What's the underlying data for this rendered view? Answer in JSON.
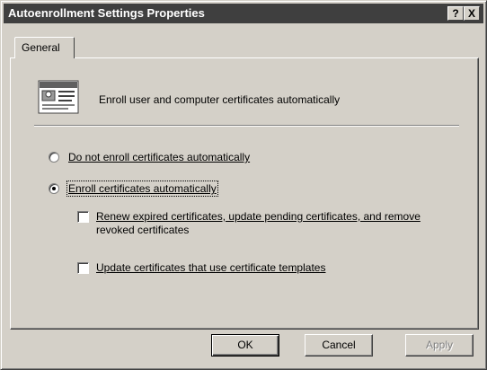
{
  "window": {
    "title": "Autoenrollment Settings Properties",
    "help_label": "?",
    "close_label": "X"
  },
  "tabs": [
    {
      "label": "General",
      "selected": true
    }
  ],
  "header": {
    "icon": "certificate-icon",
    "text": "Enroll user and computer certificates automatically"
  },
  "options": {
    "do_not_enroll": {
      "label": "Do not enroll certificates automatically",
      "selected": false
    },
    "enroll": {
      "label": "Enroll certificates automatically",
      "selected": true
    }
  },
  "checkboxes": {
    "renew": {
      "line1": "Renew expired certificates, update pending certificates, and remove",
      "line2": "revoked certificates",
      "checked": false
    },
    "update": {
      "label": "Update certificates that use certificate templates",
      "checked": false
    }
  },
  "buttons": {
    "ok": "OK",
    "cancel": "Cancel",
    "apply": "Apply",
    "apply_enabled": false
  },
  "colors": {
    "face": "#d4d0c8",
    "titlebar": "#3f3f3f",
    "disabled_text": "#808080"
  }
}
